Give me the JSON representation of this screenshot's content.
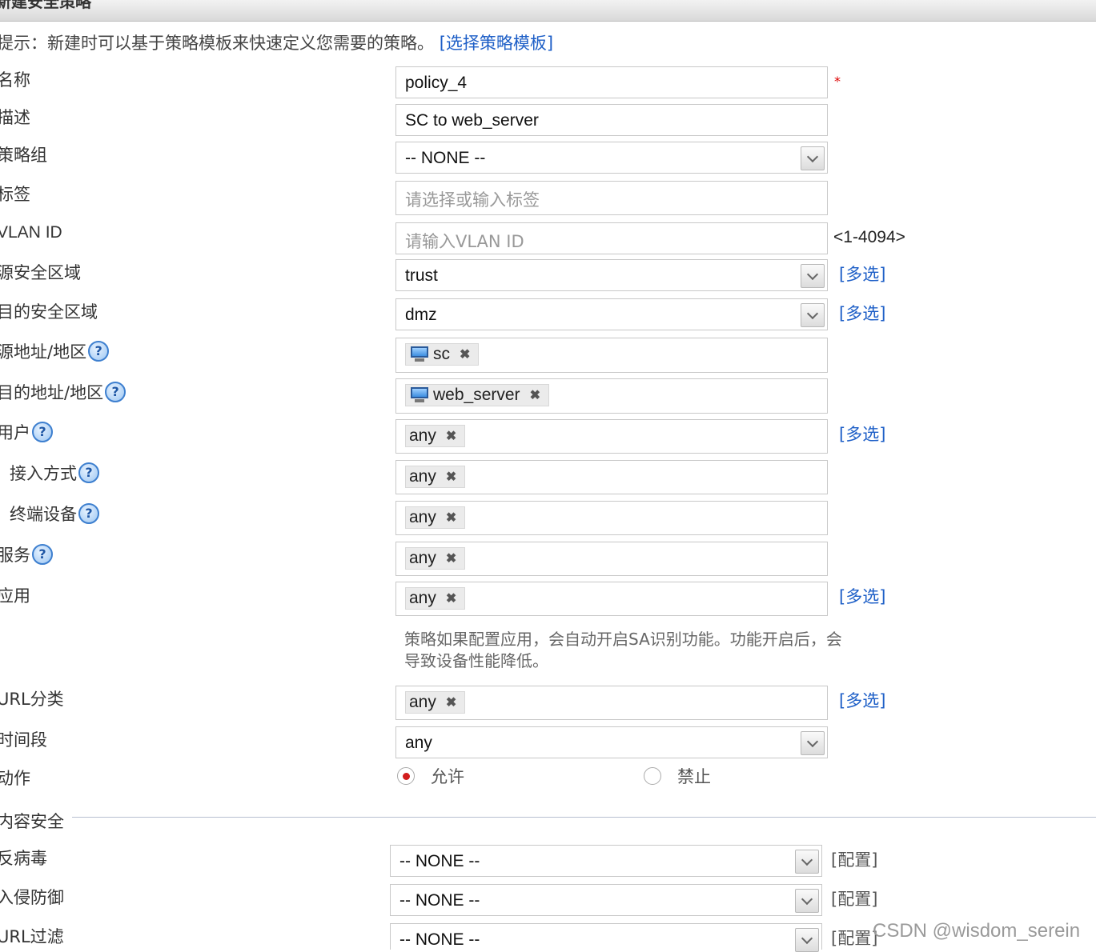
{
  "title": "新建安全策略",
  "hint": {
    "text": "提示：新建时可以基于策略模板来快速定义您需要的策略。",
    "link": "[选择策略模板]"
  },
  "labels": {
    "name": "名称",
    "desc": "描述",
    "group": "策略组",
    "tag": "标签",
    "vlan": "VLAN ID",
    "src_zone": "源安全区域",
    "dst_zone": "目的安全区域",
    "src_addr": "源地址/地区",
    "dst_addr": "目的地址/地区",
    "user": "用户",
    "access": "接入方式",
    "terminal": "终端设备",
    "service": "服务",
    "app": "应用",
    "url_cat": "URL分类",
    "time": "时间段",
    "action": "动作",
    "content_security": "内容安全",
    "antivirus": "反病毒",
    "ips": "入侵防御",
    "url_filter": "URL过滤"
  },
  "values": {
    "name": "policy_4",
    "desc": "SC to web_server",
    "group": "-- NONE --",
    "tag_placeholder": "请选择或输入标签",
    "vlan_placeholder": "请输入VLAN ID",
    "src_zone": "trust",
    "dst_zone": "dmz",
    "src_addr": "sc",
    "dst_addr": "web_server",
    "user": "any",
    "access": "any",
    "terminal": "any",
    "service": "any",
    "app": "any",
    "url_cat": "any",
    "time": "any",
    "antivirus": "-- NONE --",
    "ips": "-- NONE --",
    "url_filter": "-- NONE --"
  },
  "side": {
    "vlan_range": "<1-4094>",
    "multi": "[多选]",
    "config": "[配置]",
    "required": "*"
  },
  "app_note": "策略如果配置应用，会自动开启SA识别功能。功能开启后，会导致设备性能降低。",
  "action": {
    "allow": "允许",
    "deny": "禁止",
    "selected": "allow"
  },
  "remove_glyph": "✖",
  "help_glyph": "?",
  "watermark": "CSDN @wisdom_serein"
}
